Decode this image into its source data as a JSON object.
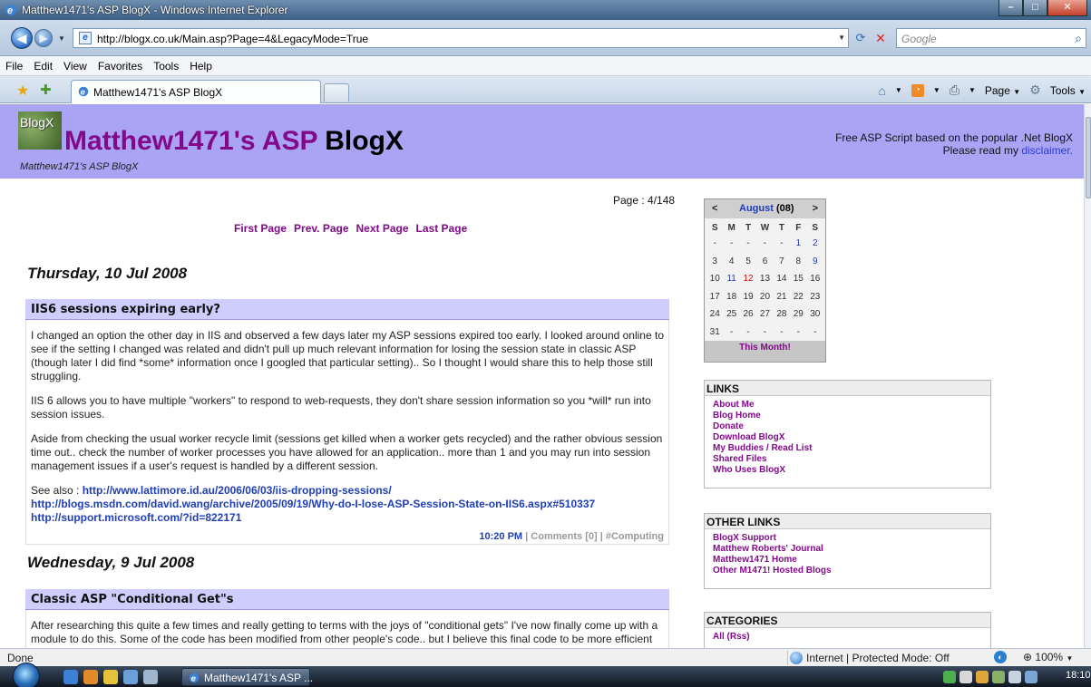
{
  "window": {
    "title": "Matthew1471's ASP BlogX - Windows Internet Explorer"
  },
  "toolbar": {
    "url": "http://blogx.co.uk/Main.asp?Page=4&LegacyMode=True",
    "search_placeholder": "Google"
  },
  "menu": [
    "File",
    "Edit",
    "View",
    "Favorites",
    "Tools",
    "Help"
  ],
  "tab": {
    "label": "Matthew1471's ASP BlogX"
  },
  "commands": {
    "page": "Page",
    "tools": "Tools"
  },
  "site": {
    "logo_text": "BlogX",
    "title_main": "Matthew1471's ASP",
    "title_blog": "BlogX",
    "subtitle": "Matthew1471's ASP BlogX",
    "tagline": "Free ASP Script based on the popular .Net BlogX",
    "disclaimer_prefix": "Please read my",
    "disclaimer_link": "disclaimer."
  },
  "pagination": {
    "page_label": "Page : 4/148",
    "first": "First Page",
    "prev": "Prev. Page",
    "next": "Next Page",
    "last": "Last Page"
  },
  "posts": [
    {
      "date": "Thursday, 10 Jul 2008",
      "title": "IIS6 sessions expiring early?",
      "paragraphs": [
        "I changed an option the other day in IIS and observed a few days later my ASP sessions expired too early. I looked around online to see if the setting I changed was related and didn't pull up much relevant information for losing the session state in classic ASP (though later I did find *some* information once I googled that particular setting).. So I thought I would share this to help those still struggling.",
        "IIS 6 allows you to have multiple \"workers\" to respond to web-requests, they don't share session information so you *will* run into session issues.",
        "Aside from checking the usual worker recycle limit (sessions get killed when a worker gets recycled) and the rather obvious session time out.. check the number of worker processes you have allowed for an application.. more than 1 and you may run into session management issues if a user's request is handled by a different session."
      ],
      "see_also": "See also :",
      "links": [
        "http://www.lattimore.id.au/2006/06/03/iis-dropping-sessions/",
        "http://blogs.msdn.com/david.wang/archive/2005/09/19/Why-do-I-lose-ASP-Session-State-on-IIS6.aspx#510337",
        "http://support.microsoft.com/?id=822171"
      ],
      "time": "10:20 PM",
      "meta": " | Comments [0] | #Computing"
    },
    {
      "date": "Wednesday, 9 Jul 2008",
      "title": "Classic ASP \"Conditional Get\"s",
      "paragraphs": [
        "After researching this quite a few times and really getting to terms with the joys of \"conditional gets\" I've now finally come up with a module to do this. Some of the code has been modified from other people's code.. but I believe this final code to be more efficient and"
      ]
    }
  ],
  "calendar": {
    "prev": "<",
    "next": ">",
    "month": "August",
    "year": "(08)",
    "dow": [
      "S",
      "M",
      "T",
      "W",
      "T",
      "F",
      "S"
    ],
    "weeks": [
      [
        "-",
        "-",
        "-",
        "-",
        "-",
        "1",
        "2"
      ],
      [
        "3",
        "4",
        "5",
        "6",
        "7",
        "8",
        "9"
      ],
      [
        "10",
        "11",
        "12",
        "13",
        "14",
        "15",
        "16"
      ],
      [
        "17",
        "18",
        "19",
        "20",
        "21",
        "22",
        "23"
      ],
      [
        "24",
        "25",
        "26",
        "27",
        "28",
        "29",
        "30"
      ],
      [
        "31",
        "-",
        "-",
        "-",
        "-",
        "-",
        "-"
      ]
    ],
    "this_month": "This Month!"
  },
  "links_box": {
    "heading": "LINKS",
    "items": [
      "About Me",
      "Blog Home",
      "Donate",
      "Download BlogX",
      "My Buddies / Read List",
      "Shared Files",
      "Who Uses BlogX"
    ]
  },
  "other_links_box": {
    "heading": "OTHER LINKS",
    "items": [
      "BlogX Support",
      "Matthew Roberts' Journal",
      "Matthew1471 Home",
      "Other M1471! Hosted Blogs"
    ]
  },
  "categories_box": {
    "heading": "CATEGORIES",
    "items": [
      "All (Rss)"
    ]
  },
  "status": {
    "left": "Done",
    "zone": "Internet | Protected Mode: Off",
    "zoom": "100%"
  },
  "taskbar": {
    "task_label": "Matthew1471's ASP ...",
    "clock": "18:10"
  },
  "colors": {
    "header_bg": "#aaa4f4",
    "title_purple": "#820a8a",
    "post_title_bg": "#cfcdfb",
    "link_blue": "#1f3eb9"
  }
}
